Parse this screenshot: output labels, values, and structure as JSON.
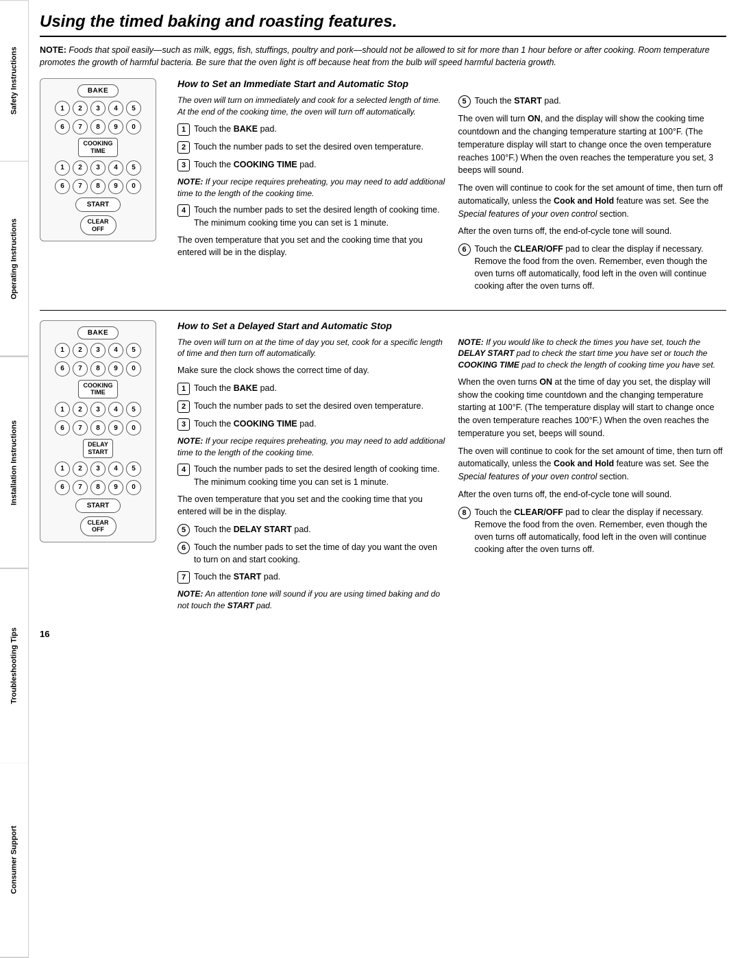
{
  "sidebar": {
    "labels": [
      "Safety Instructions",
      "Operating Instructions",
      "Installation Instructions",
      "Troubleshooting Tips",
      "Consumer Support"
    ]
  },
  "page": {
    "title": "Using the timed baking and roasting features.",
    "note": "NOTE: Foods that spoil easily—such as milk, eggs, fish, stuffings, poultry and pork—should not be allowed to sit for more than 1 hour before or after cooking. Room temperature promotes the growth of harmful bacteria. Be sure that the oven light is off because heat from the bulb will speed harmful bacteria growth.",
    "section1": {
      "heading": "How to Set an Immediate Start and Automatic Stop",
      "intro": "The oven will turn on immediately and cook for a selected length of time. At the end of the cooking time, the oven will turn off automatically.",
      "steps_left": [
        {
          "num": "1",
          "text": "Touch the BAKE pad."
        },
        {
          "num": "2",
          "text": "Touch the number pads to set the desired oven temperature."
        },
        {
          "num": "3",
          "text": "Touch the COOKING TIME pad."
        },
        {
          "note": "NOTE: If your recipe requires preheating, you may need to add additional time to the length of the cooking time."
        },
        {
          "num": "4",
          "text": "Touch the number pads to set the desired length of cooking time. The minimum cooking time you can set is 1 minute."
        },
        {
          "body": "The oven temperature that you set and the cooking time that you entered will be in the display."
        }
      ],
      "steps_right": [
        {
          "num": "5",
          "circle": true,
          "text": "Touch the START pad."
        },
        {
          "body": "The oven will turn ON, and the display will show the cooking time countdown and the changing temperature starting at 100°F. (The temperature display will start to change once the oven temperature reaches 100°F.) When the oven reaches the temperature you set, 3 beeps will sound."
        },
        {
          "body": "The oven will continue to cook for the set amount of time, then turn off automatically, unless the Cook and Hold feature was set. See the Special features of your oven control section."
        },
        {
          "body": "After the oven turns off, the end-of-cycle tone will sound."
        },
        {
          "num": "6",
          "circle": true,
          "text": "Touch the CLEAR/OFF pad to clear the display if necessary. Remove the food from the oven. Remember, even though the oven turns off automatically, food left in the oven will continue cooking after the oven turns off."
        }
      ]
    },
    "section2": {
      "heading": "How to Set a Delayed Start and Automatic Stop",
      "intro": "The oven will turn on at the time of day you set, cook for a specific length of time and then turn off automatically.",
      "make_sure": "Make sure the clock shows the correct time of day.",
      "steps_left": [
        {
          "num": "1",
          "text": "Touch the BAKE pad."
        },
        {
          "num": "2",
          "text": "Touch the number pads to set the desired oven temperature."
        },
        {
          "num": "3",
          "text": "Touch the COOKING TIME pad."
        },
        {
          "note": "NOTE: If your recipe requires preheating, you may need to add additional time to the length of the cooking time."
        },
        {
          "num": "4",
          "text": "Touch the number pads to set the desired length of cooking time. The minimum cooking time you can set is 1 minute."
        },
        {
          "body": "The oven temperature that you set and the cooking time that you entered will be in the display."
        },
        {
          "num": "5",
          "circle": true,
          "text": "Touch the DELAY START pad."
        },
        {
          "num": "6",
          "circle": true,
          "text": "Touch the number pads to set the time of day you want the oven to turn on and start cooking."
        },
        {
          "num": "7",
          "text": "Touch the START pad."
        },
        {
          "note_bottom": "NOTE: An attention tone will sound if you are using timed baking and do not touch the START pad."
        }
      ],
      "steps_right": [
        {
          "note_top": "NOTE: If you would like to check the times you have set, touch the DELAY START pad to check the start time you have set or touch the COOKING TIME pad to check the length of cooking time you have set."
        },
        {
          "body": "When the oven turns ON at the time of day you set, the display will show the cooking time countdown and the changing temperature starting at 100°F. (The temperature display will start to change once the oven temperature reaches 100°F.) When the oven reaches the temperature you set, beeps will sound."
        },
        {
          "body": "The oven will continue to cook for the set amount of time, then turn off automatically, unless the Cook and Hold feature was set. See the Special features of your oven control section."
        },
        {
          "body": "After the oven turns off, the end-of-cycle tone will sound."
        },
        {
          "num": "8",
          "circle": true,
          "text": "Touch the CLEAR/OFF pad to clear the display if necessary. Remove the food from the oven. Remember, even though the oven turns off automatically, food left in the oven will continue cooking after the oven turns off."
        }
      ]
    },
    "page_number": "16"
  },
  "oven_panel": {
    "bake": "BAKE",
    "cooking_time_line1": "COOKING",
    "cooking_time_line2": "TIME",
    "start": "START",
    "clear_line1": "CLEAR",
    "clear_line2": "OFF",
    "delay_line1": "DELAY",
    "delay_line2": "START",
    "num_row1": [
      "1",
      "2",
      "3",
      "4",
      "5"
    ],
    "num_row2": [
      "6",
      "7",
      "8",
      "9",
      "0"
    ]
  }
}
